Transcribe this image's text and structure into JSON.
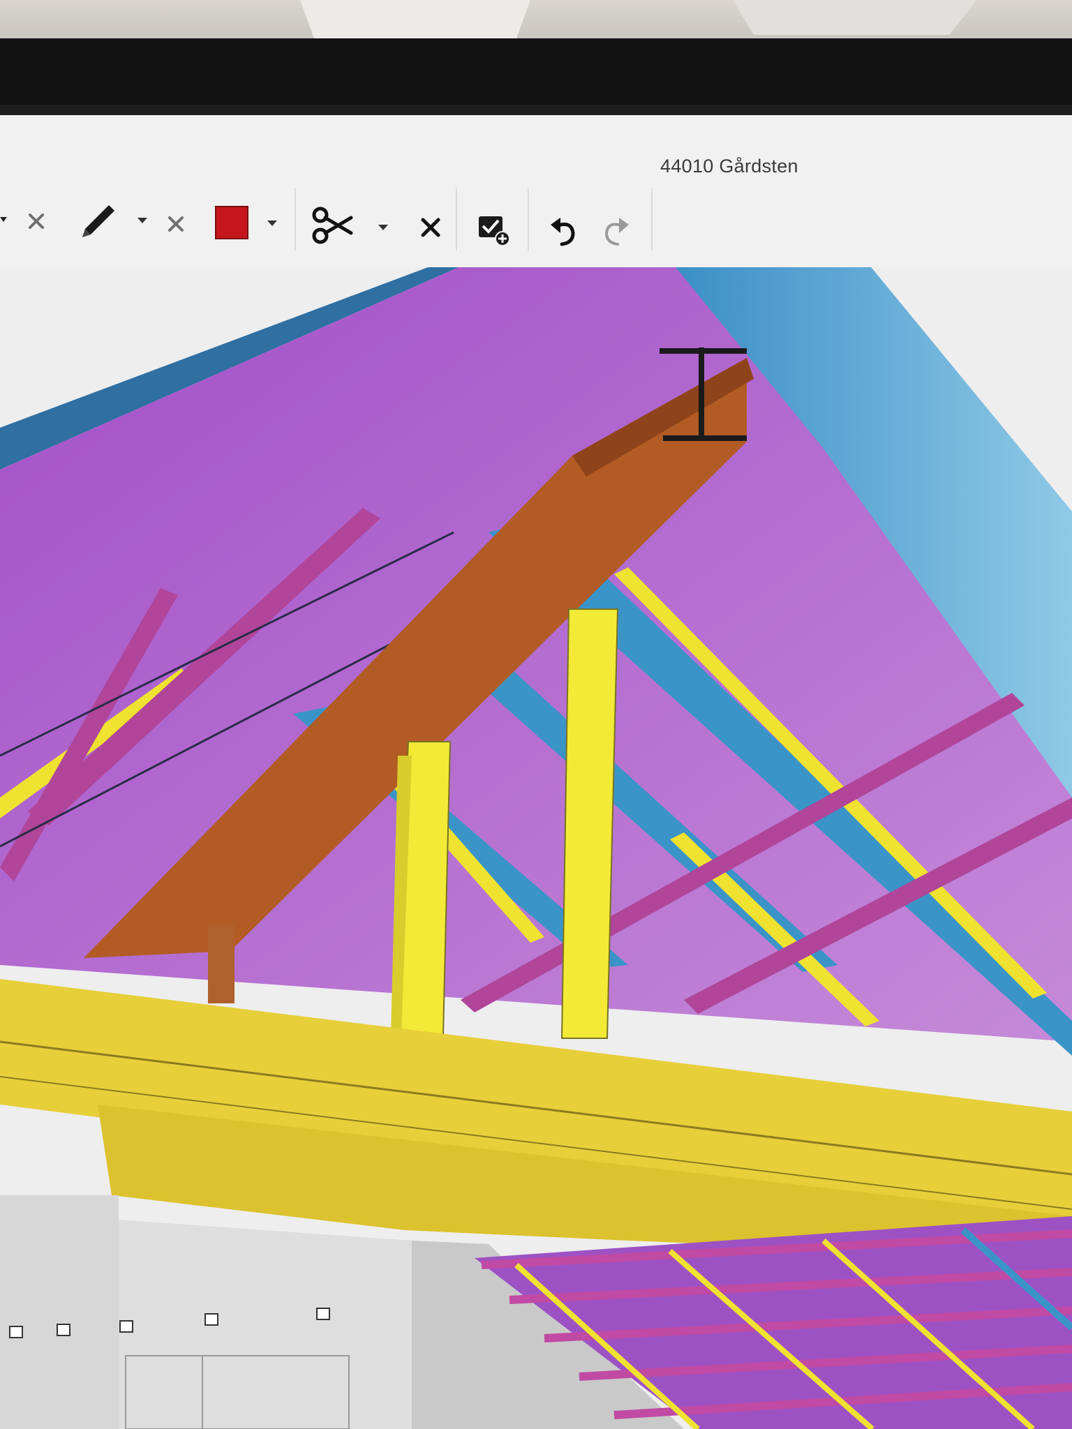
{
  "window": {
    "title": "44010 Gårdsten"
  },
  "toolbar": {
    "items": [
      {
        "name": "clear-x-1",
        "icon": "close-icon"
      },
      {
        "name": "pen-tool",
        "icon": "pencil-icon"
      },
      {
        "name": "pen-dropdown",
        "icon": "chevron-down-icon"
      },
      {
        "name": "clear-x-2",
        "icon": "close-icon"
      },
      {
        "name": "color-swatch",
        "icon": "color-square-icon",
        "color": "#c4161c"
      },
      {
        "name": "color-dropdown",
        "icon": "chevron-down-icon"
      },
      {
        "name": "cut-tool",
        "icon": "scissors-icon"
      },
      {
        "name": "cut-dropdown",
        "icon": "chevron-down-icon"
      },
      {
        "name": "delete",
        "icon": "close-icon"
      },
      {
        "name": "save-markup",
        "icon": "checklist-add-icon"
      },
      {
        "name": "undo",
        "icon": "undo-icon"
      },
      {
        "name": "redo",
        "icon": "redo-icon"
      }
    ]
  },
  "model": {
    "colors": {
      "roof_purple": "#a356c9",
      "roof_blue": "#3a9ed0",
      "beam_brown": "#b45f26",
      "post_yellow": "#f1e53a",
      "plate_yellow": "#e7cf3a",
      "brace_magenta": "#b0459a",
      "wall_grey": "#d9d9d9"
    }
  }
}
